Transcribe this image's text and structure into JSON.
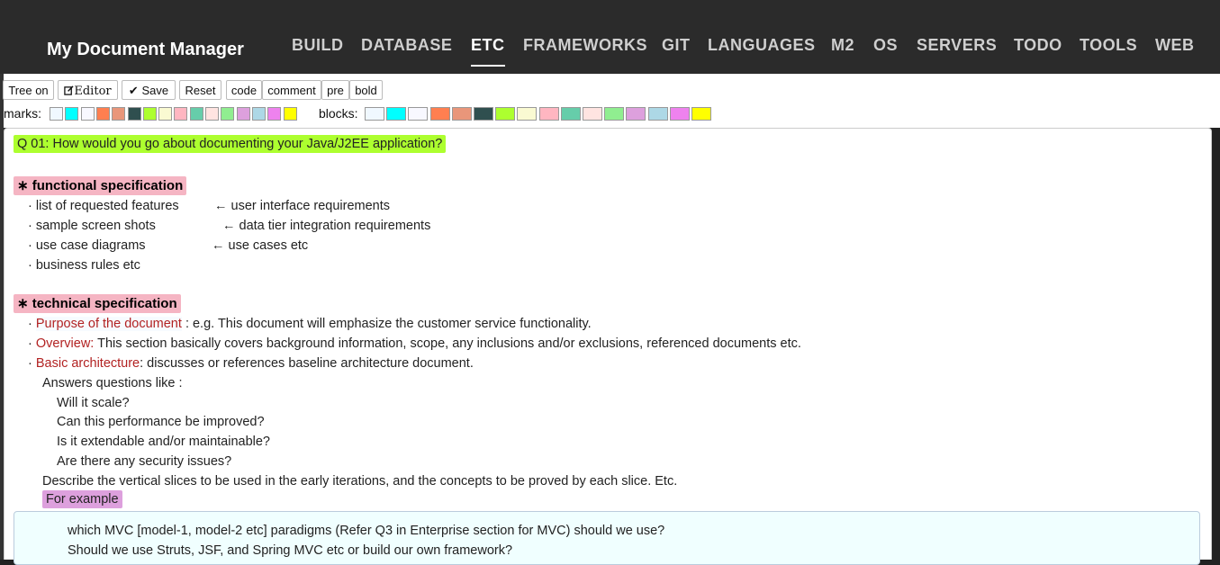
{
  "app": {
    "title": "My Document Manager"
  },
  "nav": [
    {
      "label": "BUILD",
      "active": false
    },
    {
      "label": "DATABASE",
      "active": false
    },
    {
      "label": "ETC",
      "active": true
    },
    {
      "label": "FRAMEWORKS",
      "active": false
    },
    {
      "label": "GIT",
      "active": false
    },
    {
      "label": "LANGUAGES",
      "active": false
    },
    {
      "label": "M2",
      "active": false
    },
    {
      "label": "OS",
      "active": false
    },
    {
      "label": "SERVERS",
      "active": false
    },
    {
      "label": "TODO",
      "active": false
    },
    {
      "label": "TOOLS",
      "active": false
    },
    {
      "label": "WEB",
      "active": false
    }
  ],
  "toolbar": {
    "tree_on": "Tree on",
    "editor": "Editor",
    "save": "Save",
    "reset": "Reset",
    "code": "code",
    "comment": "comment",
    "pre": "pre",
    "bold": "bold",
    "marks_label": "marks:",
    "blocks_label": "blocks:",
    "editor_icon": "edit-icon",
    "save_icon": "check-icon"
  },
  "marks_colors": [
    "#f0f8ff",
    "#00ffff",
    "#f8f8ff",
    "#ff7f50",
    "#e9967a",
    "#2f4f4f",
    "#adff2f",
    "#fafad2",
    "#ffb6c1",
    "#66cdaa",
    "#ffe4e1",
    "#90ee90",
    "#dda0dd",
    "#add8e6",
    "#ee82ee",
    "#ffff00"
  ],
  "blocks_colors": [
    "#f0f8ff",
    "#00ffff",
    "#f8f8ff",
    "#ff7f50",
    "#e9967a",
    "#2f4f4f",
    "#adff2f",
    "#fafad2",
    "#ffb6c1",
    "#66cdaa",
    "#ffe4e1",
    "#90ee90",
    "#dda0dd",
    "#add8e6",
    "#ee82ee",
    "#ffff00"
  ],
  "doc": {
    "question": "Q 01: How would you go about documenting your Java/J2EE application?",
    "func_heading": "∗ functional specification",
    "func_items": [
      "· list of requested features",
      "· sample screen shots",
      "· use case diagrams",
      "· business rules etc"
    ],
    "func_notes": [
      "← user interface requirements",
      "← data tier integration requirements",
      "← use cases etc"
    ],
    "tech_heading": "∗ technical specification",
    "purpose_label": "Purpose of the document",
    "purpose_text": ": e.g. This document will emphasize the customer service functionality.",
    "overview_label": "Overview:",
    "overview_text": "This section basically covers background information, scope, any inclusions and/or exclusions, referenced documents etc.",
    "arch_label": "Basic architecture",
    "arch_text": ": discusses or references baseline architecture document.",
    "answers": "Answers questions like :",
    "q1": "Will it scale?",
    "q2": "Can this performance be improved?",
    "q3": "Is it extendable and/or maintainable?",
    "q4": "Are there any security issues?",
    "describe": "Describe the vertical slices to be used in the early iterations, and the concepts to be proved by each slice. Etc.",
    "for_example": "For example",
    "block_line1": "which MVC [model-1, model-2 etc] paradigms (Refer Q3 in Enterprise section for MVC) should we use?",
    "block_line2": "Should we use Struts, JSF, and Spring MVC etc or build our own framework?"
  }
}
